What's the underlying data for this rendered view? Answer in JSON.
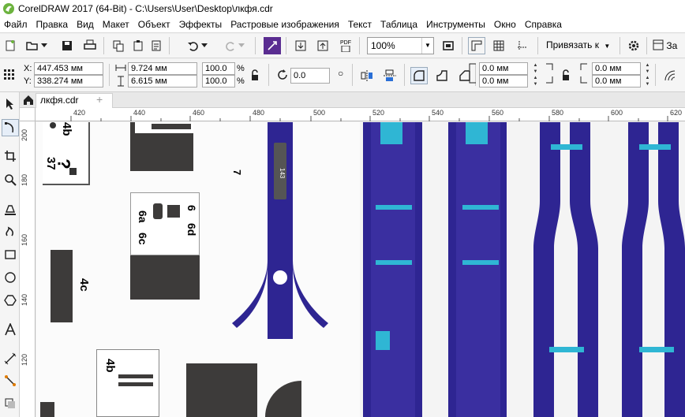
{
  "window": {
    "title": "CorelDRAW 2017 (64-Bit) - C:\\Users\\User\\Desktop\\лкфя.cdr"
  },
  "menu": [
    "Файл",
    "Правка",
    "Вид",
    "Макет",
    "Объект",
    "Эффекты",
    "Растровые изображения",
    "Текст",
    "Таблица",
    "Инструменты",
    "Окно",
    "Справка"
  ],
  "toolbar": {
    "zoom": "100%",
    "snap_label": "Привязать к",
    "launch_label": "За",
    "pdf_label": "PDF"
  },
  "propbar": {
    "x_label": "X:",
    "y_label": "Y:",
    "x_value": "447.453 мм",
    "y_value": "338.274 мм",
    "width_value": "9.724 мм",
    "height_value": "6.615 мм",
    "scale_x": "100.0",
    "scale_y": "100.0",
    "percent": "%",
    "angle": "0.0",
    "corner_tl": "0.0 мм",
    "corner_bl": "0.0 мм",
    "corner_tr": "0.0 мм",
    "corner_br": "0.0 мм"
  },
  "document_tab": "лкфя.cdr",
  "ruler": {
    "h_ticks": [
      "420",
      "440",
      "460",
      "480",
      "500",
      "520",
      "540",
      "560",
      "580",
      "600",
      "620"
    ],
    "v_ticks": [
      "200",
      "180",
      "160",
      "140",
      "120"
    ]
  },
  "canvas_text": {
    "label_4b_top": "4b",
    "label_37": "37",
    "label_6a": "6a",
    "label_6c": "6c",
    "label_6": "6",
    "label_6d": "6d",
    "label_4c": "4c",
    "label_7": "7",
    "label_4b_bottom": "4b",
    "label_143": "143"
  },
  "colors": {
    "bar_blue": "#2e2592",
    "accent_cyan": "#2fb6d4",
    "scan_dark": "#3d3b3a",
    "corel_green": "#6cb33e",
    "effects_purple": "#5a2d91"
  }
}
